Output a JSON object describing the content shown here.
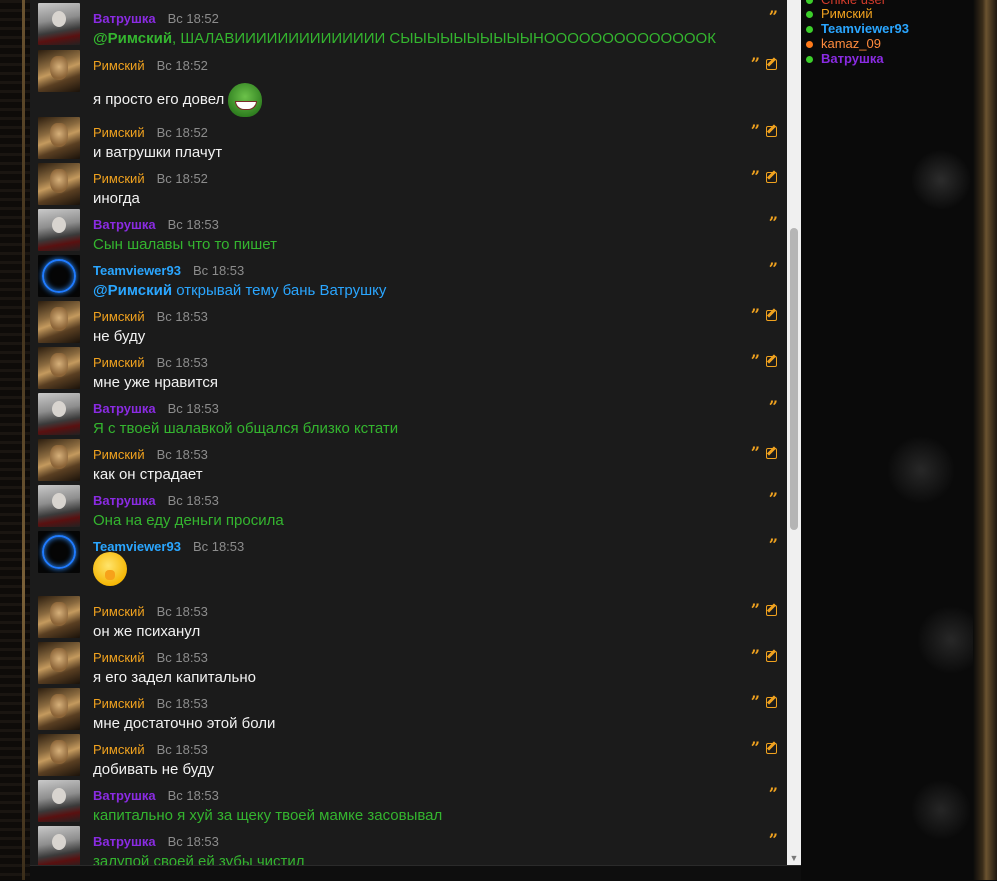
{
  "chat": {
    "messages": [
      {
        "author": "Ватрушка",
        "kind": "vat",
        "time": "Вс 18:52",
        "mention": "@Римский",
        "text": ", ШАЛАВИИИИИИИИИИИИИИ СЫЫЫЫЫЫЫЫЫЫНООООООООООООООК",
        "editable": false
      },
      {
        "author": "Римский",
        "kind": "rim",
        "time": "Вс 18:52",
        "text": "я просто его довел",
        "emoji": "frog-emoji",
        "editable": true
      },
      {
        "author": "Римский",
        "kind": "rim",
        "time": "Вс 18:52",
        "text": "и ватрушки плачут",
        "editable": true
      },
      {
        "author": "Римский",
        "kind": "rim",
        "time": "Вс 18:52",
        "text": "иногда",
        "editable": true
      },
      {
        "author": "Ватрушка",
        "kind": "vat",
        "time": "Вс 18:53",
        "text": "Сын шалавы что то пишет",
        "editable": false
      },
      {
        "author": "Teamviewer93",
        "kind": "team",
        "time": "Вс 18:53",
        "mention": "@Римский",
        "text": " открывай тему бань Ватрушку",
        "editable": false
      },
      {
        "author": "Римский",
        "kind": "rim",
        "time": "Вс 18:53",
        "text": "не буду",
        "editable": true
      },
      {
        "author": "Римский",
        "kind": "rim",
        "time": "Вс 18:53",
        "text": "мне уже нравится",
        "editable": true
      },
      {
        "author": "Ватрушка",
        "kind": "vat",
        "time": "Вс 18:53",
        "text": "Я с твоей шалавкой общался близко кстати",
        "editable": false
      },
      {
        "author": "Римский",
        "kind": "rim",
        "time": "Вс 18:53",
        "text": "как он страдает",
        "editable": true
      },
      {
        "author": "Ватрушка",
        "kind": "vat",
        "time": "Вс 18:53",
        "text": "Она на еду деньги просила",
        "editable": false
      },
      {
        "author": "Teamviewer93",
        "kind": "team",
        "time": "Вс 18:53",
        "text": "",
        "emoji": "thinking-emoji",
        "editable": false
      },
      {
        "author": "Римский",
        "kind": "rim",
        "time": "Вс 18:53",
        "text": "он же психанул",
        "editable": true
      },
      {
        "author": "Римский",
        "kind": "rim",
        "time": "Вс 18:53",
        "text": "я его задел капитально",
        "editable": true
      },
      {
        "author": "Римский",
        "kind": "rim",
        "time": "Вс 18:53",
        "text": "мне достаточно этой боли",
        "editable": true
      },
      {
        "author": "Римский",
        "kind": "rim",
        "time": "Вс 18:53",
        "text": "добивать не буду",
        "editable": true
      },
      {
        "author": "Ватрушка",
        "kind": "vat",
        "time": "Вс 18:53",
        "text": "капитально я хуй за щеку твоей мамке засовывал",
        "editable": false
      },
      {
        "author": "Ватрушка",
        "kind": "vat",
        "time": "Вс 18:53",
        "text": "залупой своей ей зубы чистил",
        "editable": false
      }
    ],
    "icons": {
      "quote": "quote-icon",
      "edit": "edit-icon",
      "scroll_down": "▼"
    }
  },
  "online": {
    "users": [
      {
        "name": "Римский",
        "color": "u-rim",
        "status": "green"
      },
      {
        "name": "Teamviewer93",
        "color": "u-team",
        "status": "green"
      },
      {
        "name": "kamaz_09",
        "color": "u-kamaz",
        "status": "orange"
      },
      {
        "name": "Ватрушка",
        "color": "u-vat",
        "status": "green"
      }
    ]
  },
  "colors": {
    "rim": "#f0a21f",
    "vat": "#8a2be2",
    "vat_text": "#34b52f",
    "team": "#2aa6ff",
    "panel": "#1b1b1b"
  }
}
